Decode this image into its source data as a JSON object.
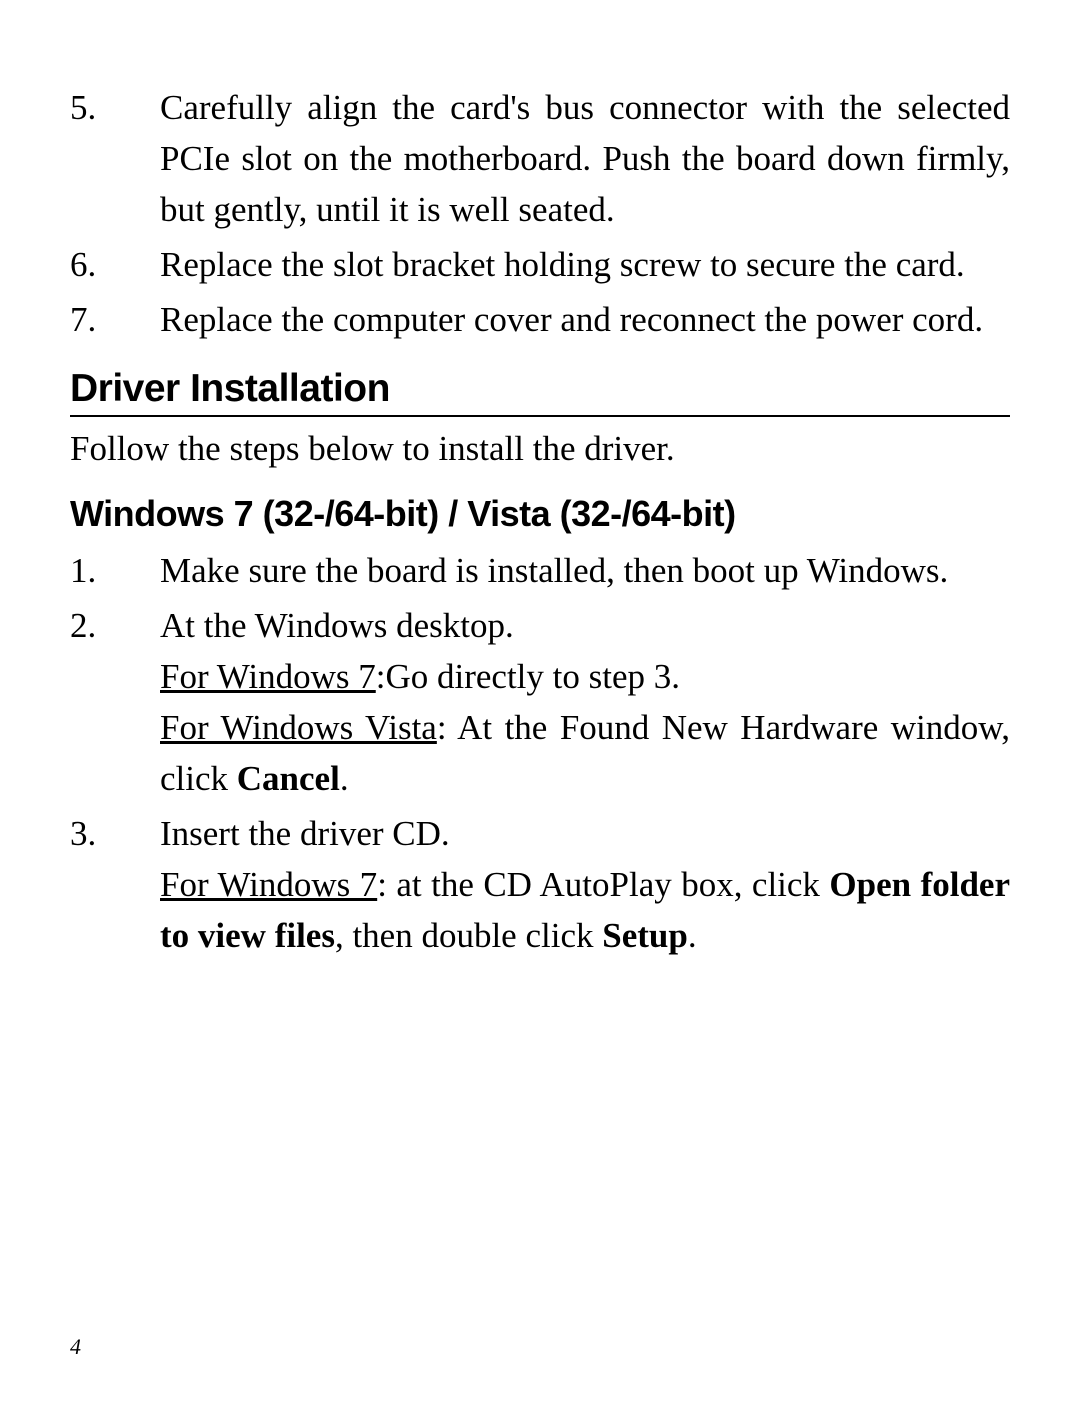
{
  "hardware_steps": [
    {
      "num": "5.",
      "text": "Carefully align the card's bus connector with the selected PCIe slot on the motherboard. Push the board down firmly, but gently, until it is well seated."
    },
    {
      "num": "6.",
      "text": "Replace the slot bracket holding screw to secure the card."
    },
    {
      "num": "7.",
      "text": "Replace the computer cover and reconnect the power cord."
    }
  ],
  "section_heading": "Driver Installation",
  "intro": "Follow the steps below to install the driver.",
  "sub_heading": "Windows 7 (32-/64-bit) / Vista (32-/64-bit)",
  "driver_steps": {
    "s1": {
      "num": "1.",
      "text": "Make sure the board is installed, then boot up Windows."
    },
    "s2": {
      "num": "2.",
      "line1": "At the Windows desktop.",
      "win7_label": "For Windows 7",
      "win7_rest": ":Go directly to step 3.",
      "vista_label": "For Windows Vista",
      "vista_rest_pre": ": At the Found New Hardware window, click ",
      "vista_bold": "Cancel",
      "vista_rest_post": "."
    },
    "s3": {
      "num": "3.",
      "line1": "Insert the driver CD.",
      "win7_label": "For Windows 7",
      "win7_pre": ": at the CD AutoPlay box, click ",
      "win7_bold1": "Open folder to view files",
      "win7_mid": ", then double click ",
      "win7_bold2": "Setup",
      "win7_post": "."
    }
  },
  "page_number": "4"
}
